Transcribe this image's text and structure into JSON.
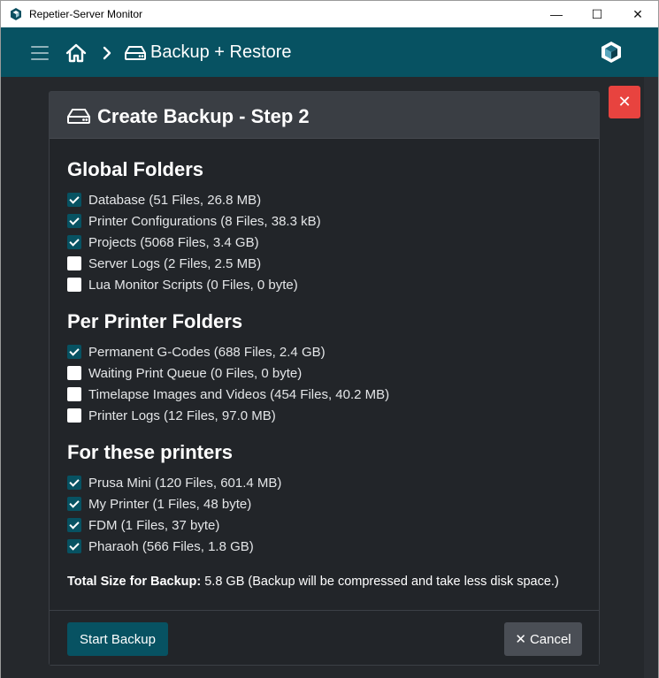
{
  "window": {
    "title": "Repetier-Server Monitor",
    "minimize": "—",
    "maximize": "☐",
    "close": "✕"
  },
  "nav": {
    "breadcrumb": "Backup + Restore"
  },
  "close_glyph": "✕",
  "dialog": {
    "title": "Create Backup - Step 2",
    "sections": [
      {
        "title": "Global Folders",
        "items": [
          {
            "label": "Database (51 Files, 26.8 MB)",
            "checked": true
          },
          {
            "label": "Printer Configurations (8 Files, 38.3 kB)",
            "checked": true
          },
          {
            "label": "Projects (5068 Files, 3.4 GB)",
            "checked": true
          },
          {
            "label": "Server Logs (2 Files, 2.5 MB)",
            "checked": false
          },
          {
            "label": "Lua Monitor Scripts (0 Files, 0 byte)",
            "checked": false
          }
        ]
      },
      {
        "title": "Per Printer Folders",
        "items": [
          {
            "label": "Permanent G-Codes (688 Files, 2.4 GB)",
            "checked": true
          },
          {
            "label": "Waiting Print Queue (0 Files, 0 byte)",
            "checked": false
          },
          {
            "label": "Timelapse Images and Videos (454 Files, 40.2 MB)",
            "checked": false
          },
          {
            "label": "Printer Logs (12 Files, 97.0 MB)",
            "checked": false
          }
        ]
      },
      {
        "title": "For these printers",
        "items": [
          {
            "label": "Prusa Mini (120 Files, 601.4 MB)",
            "checked": true
          },
          {
            "label": "My Printer (1 Files, 48 byte)",
            "checked": true
          },
          {
            "label": "FDM (1 Files, 37 byte)",
            "checked": true
          },
          {
            "label": "Pharaoh (566 Files, 1.8 GB)",
            "checked": true
          }
        ]
      }
    ],
    "total_label": "Total Size for Backup:",
    "total_value": "5.8 GB (Backup will be compressed and take less disk space.)",
    "start_button": "Start Backup",
    "cancel_button": "Cancel"
  },
  "colors": {
    "accent": "#075262",
    "danger": "#e8433f",
    "background": "#25282c"
  }
}
